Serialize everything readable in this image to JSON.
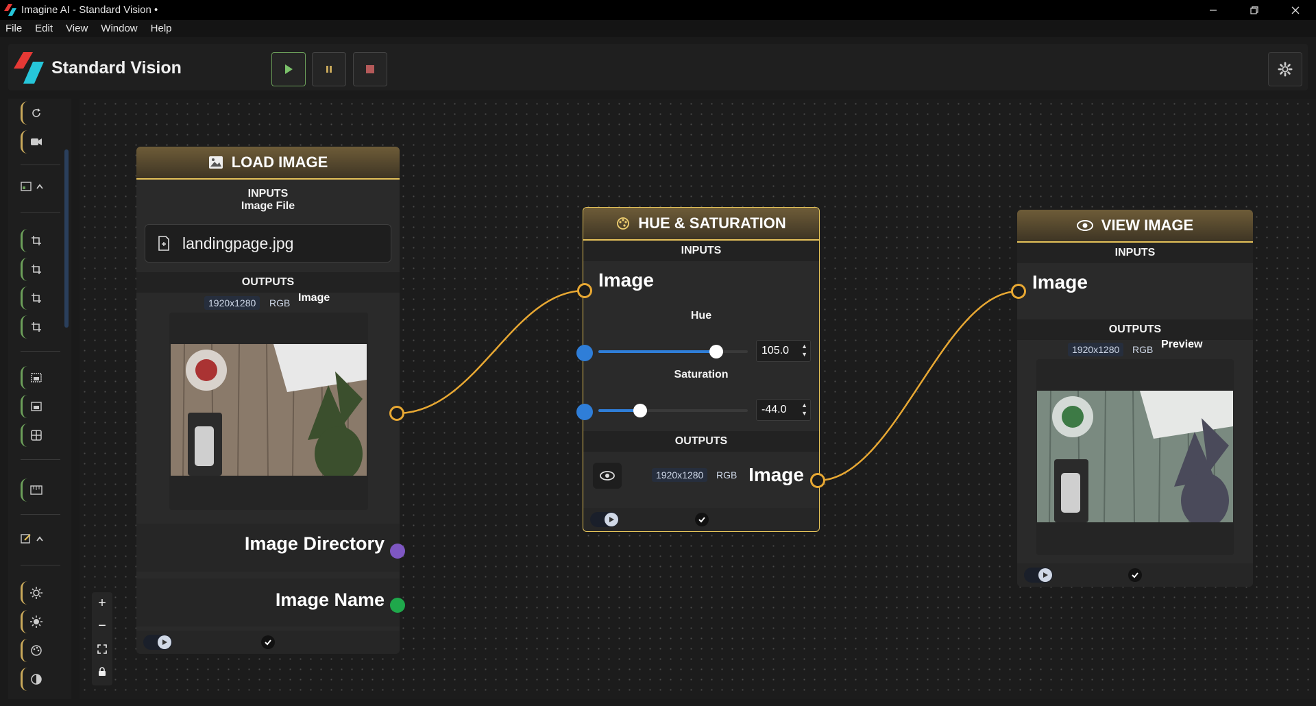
{
  "window": {
    "title": "Imagine AI - Standard Vision •",
    "controls": [
      "minimize-icon",
      "restore-icon",
      "close-icon"
    ]
  },
  "menu": [
    "File",
    "Edit",
    "View",
    "Window",
    "Help"
  ],
  "toolbar": {
    "brand_name": "Standard Vision",
    "buttons": [
      "play-icon",
      "pause-icon",
      "stop-icon"
    ],
    "settings_icon": "gear-icon"
  },
  "sidebar": {
    "tools": [
      "refresh-icon",
      "camera-icon",
      "crop-icon",
      "crop-icon",
      "crop-icon",
      "crop-icon",
      "image-icon",
      "image-icon",
      "grid-icon",
      "ruler-icon",
      "sun-icon",
      "sun-icon",
      "palette-icon",
      "contrast-icon"
    ],
    "groups": [
      "image-chevron-up",
      "edit-chevron-up"
    ]
  },
  "nodes": {
    "load_image": {
      "title": "LOAD IMAGE",
      "inputs_label": "INPUTS",
      "input_name": "Image File",
      "file_name": "landingpage.jpg",
      "outputs_label": "OUTPUTS",
      "dims": "1920x1280",
      "mode": "RGB",
      "output_name": "Image",
      "directory_label": "Image Directory",
      "name_label": "Image Name"
    },
    "hue_saturation": {
      "title": "HUE & SATURATION",
      "inputs_label": "INPUTS",
      "input_name": "Image",
      "hue_label": "Hue",
      "hue_value": "105.0",
      "hue_fraction": 0.79,
      "saturation_label": "Saturation",
      "saturation_value": "-44.0",
      "saturation_fraction": 0.28,
      "outputs_label": "OUTPUTS",
      "dims": "1920x1280",
      "mode": "RGB",
      "output_name": "Image"
    },
    "view_image": {
      "title": "VIEW IMAGE",
      "inputs_label": "INPUTS",
      "input_name": "Image",
      "outputs_label": "OUTPUTS",
      "dims": "1920x1280",
      "mode": "RGB",
      "output_name": "Preview"
    }
  },
  "zoom_controls": [
    "zoom-in-icon",
    "zoom-out-icon",
    "fit-view-icon",
    "lock-icon"
  ],
  "colors": {
    "accent_gold": "#e6c25a",
    "wire": "#e8a833",
    "slider_blue": "#2f7ed8",
    "play_green": "#6c9f5a",
    "port_purple": "#7e57c2",
    "port_green": "#1fa84b"
  }
}
